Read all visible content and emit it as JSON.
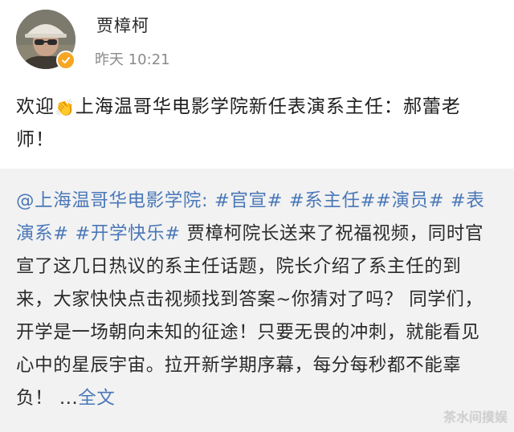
{
  "user": {
    "name": "贾樟柯",
    "time": "昨天 10:21",
    "verified": true,
    "verified_color": "#f5a623"
  },
  "post": {
    "text_before_emoji": "欢迎",
    "emoji": "👏",
    "text_after_emoji": "上海温哥华电影学院新任表演系主任：郝蕾老师！"
  },
  "repost": {
    "mention": "@上海温哥华电影学院",
    "colon": ": ",
    "hashtags": [
      "#官宣#",
      "#系主任#",
      "#演员#",
      "#表演系#",
      "#开学快乐#"
    ],
    "body": " 贾樟柯院长送来了祝福视频，同时官宣了这几日热议的系主任话题，院长介绍了系主任的到来，大家快快点击视频找到答案~你猜对了吗？ 同学们，开学是一场朝向未知的征途！只要无畏的冲刺，就能看见心中的星辰宇宙。拉开新学期序幕，每分每秒都不能辜负！ ",
    "ellipsis": "...",
    "more_link": "全文"
  },
  "watermark": "茶水间摸娱",
  "colors": {
    "link": "#4a78b8",
    "card_bg": "#f2f2f2",
    "time_text": "#8a8a8a"
  }
}
